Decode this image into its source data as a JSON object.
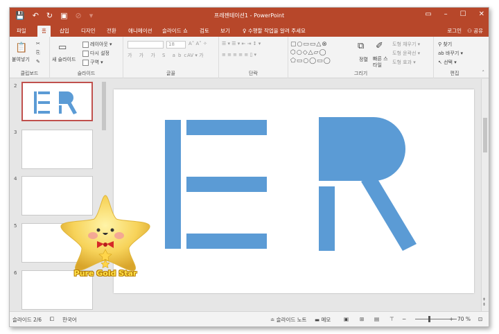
{
  "app": {
    "window_title": "프레젠테이션1 - PowerPoint",
    "accent_color": "#b7472a",
    "shape_color": "#5b9bd5"
  },
  "qat": {
    "icons": [
      "save-icon",
      "undo-icon",
      "redo-icon",
      "present-icon"
    ]
  },
  "tabs": [
    {
      "label": "파일",
      "active": false
    },
    {
      "label": "홈",
      "active": true
    },
    {
      "label": "삽입",
      "active": false
    },
    {
      "label": "디자인",
      "active": false
    },
    {
      "label": "전환",
      "active": false
    },
    {
      "label": "애니메이션",
      "active": false
    },
    {
      "label": "슬라이드 쇼",
      "active": false
    },
    {
      "label": "검토",
      "active": false
    },
    {
      "label": "보기",
      "active": false
    },
    {
      "label": "♀ 수행할 작업을 알려 주세요",
      "active": false
    }
  ],
  "account": {
    "login": "로그인",
    "share": "공유"
  },
  "ribbon": {
    "clipboard": {
      "label": "클립보드",
      "paste": "붙여넣기"
    },
    "slides": {
      "label": "슬라이드",
      "new_slide": "새 슬라이드",
      "layout": "레이아웃 ▾",
      "reset": "다시 설정",
      "section": "구역 ▾"
    },
    "font": {
      "label": "글꼴",
      "size": "18"
    },
    "paragraph": {
      "label": "단락"
    },
    "drawing": {
      "label": "그리기",
      "arrange": "정렬",
      "quick_styles": "빠른 스타일",
      "fill": "도형 채우기 ▾",
      "outline": "도형 윤곽선 ▾",
      "effects": "도형 효과 ▾"
    },
    "editing": {
      "label": "편집",
      "find": "찾기",
      "replace": "바꾸기 ▾",
      "select": "선택 ▾"
    }
  },
  "thumbnails": [
    {
      "number": "2",
      "selected": true
    },
    {
      "number": "3",
      "selected": false
    },
    {
      "number": "4",
      "selected": false
    },
    {
      "number": "5",
      "selected": false
    },
    {
      "number": "6",
      "selected": false
    }
  ],
  "slide_text": "ER",
  "sticker": {
    "caption": "Pure Gold Star"
  },
  "status": {
    "slide_position": "슬라이드 2/6",
    "language": "한국어",
    "notes": "슬라이드 노트",
    "comments": "메모",
    "zoom": "70 %"
  }
}
